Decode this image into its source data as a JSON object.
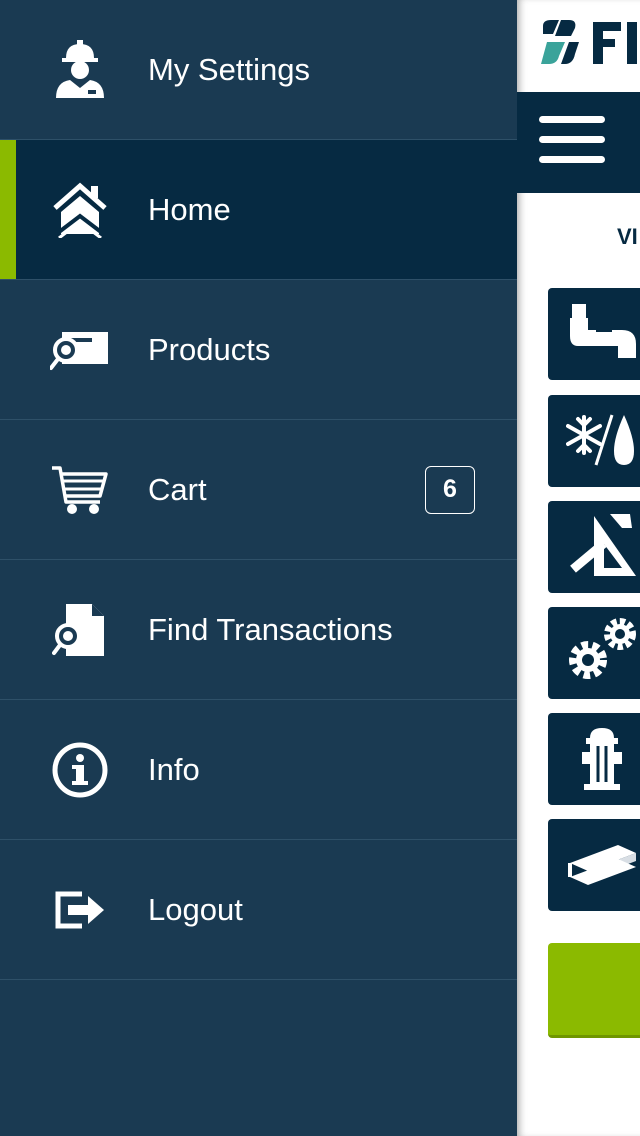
{
  "menu": {
    "items": [
      {
        "label": "My Settings",
        "icon": "worker-icon"
      },
      {
        "label": "Home",
        "icon": "home-icon",
        "active": true
      },
      {
        "label": "Products",
        "icon": "product-search-icon"
      },
      {
        "label": "Cart",
        "icon": "cart-icon",
        "badge": "6"
      },
      {
        "label": "Find Transactions",
        "icon": "document-search-icon"
      },
      {
        "label": "Info",
        "icon": "info-icon"
      },
      {
        "label": "Logout",
        "icon": "logout-icon"
      }
    ]
  },
  "content": {
    "view_label": "VI",
    "categories": [
      "pipe-icon",
      "hvac-icon",
      "tools-icon",
      "gears-icon",
      "hydrant-icon",
      "steel-beam-icon"
    ]
  },
  "colors": {
    "menu_bg": "#1a3a52",
    "active_bg": "#062a42",
    "accent": "#8bba00",
    "brand_dark": "#062a42"
  }
}
